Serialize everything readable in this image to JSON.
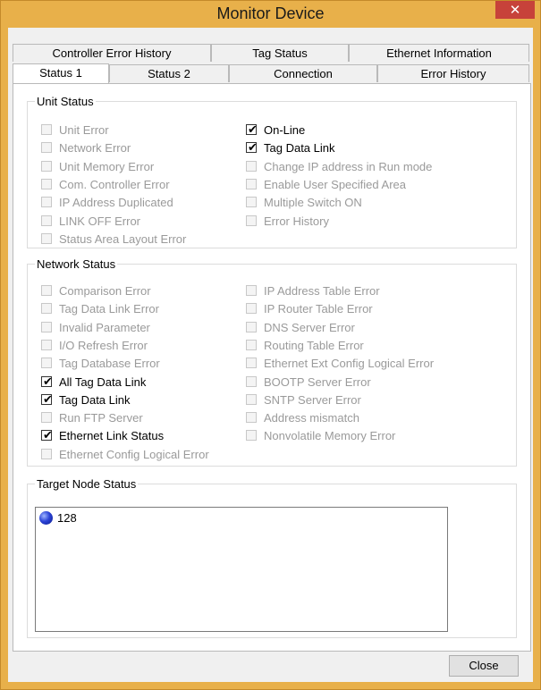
{
  "window": {
    "title": "Monitor Device",
    "close_glyph": "✕",
    "frame_color": "#e8b04a"
  },
  "tabs": {
    "row_back": [
      "Controller Error History",
      "Tag Status",
      "Ethernet Information"
    ],
    "row_front": [
      "Status 1",
      "Status 2",
      "Connection",
      "Error History"
    ],
    "active": "Status 1"
  },
  "unit_status": {
    "title": "Unit Status",
    "left": [
      {
        "label": "Unit Error",
        "checked": false
      },
      {
        "label": "Network Error",
        "checked": false
      },
      {
        "label": "Unit Memory Error",
        "checked": false
      },
      {
        "label": "Com. Controller Error",
        "checked": false
      },
      {
        "label": "IP Address Duplicated",
        "checked": false
      },
      {
        "label": "LINK OFF Error",
        "checked": false
      },
      {
        "label": "Status Area Layout Error",
        "checked": false
      }
    ],
    "right": [
      {
        "label": "On-Line",
        "checked": true
      },
      {
        "label": "Tag Data Link",
        "checked": true
      },
      {
        "label": "Change IP address in Run mode",
        "checked": false
      },
      {
        "label": "Enable User Specified Area",
        "checked": false
      },
      {
        "label": "Multiple Switch ON",
        "checked": false
      },
      {
        "label": "Error History",
        "checked": false
      }
    ]
  },
  "network_status": {
    "title": "Network Status",
    "left": [
      {
        "label": "Comparison Error",
        "checked": false
      },
      {
        "label": "Tag Data Link Error",
        "checked": false
      },
      {
        "label": "Invalid Parameter",
        "checked": false
      },
      {
        "label": "I/O Refresh Error",
        "checked": false
      },
      {
        "label": "Tag Database Error",
        "checked": false
      },
      {
        "label": "All Tag Data Link",
        "checked": true
      },
      {
        "label": "Tag Data Link",
        "checked": true
      },
      {
        "label": "Run FTP Server",
        "checked": false
      },
      {
        "label": "Ethernet Link Status",
        "checked": true
      },
      {
        "label": "Ethernet Config Logical Error",
        "checked": false
      }
    ],
    "right": [
      {
        "label": "IP Address Table Error",
        "checked": false
      },
      {
        "label": "IP Router Table Error",
        "checked": false
      },
      {
        "label": "DNS Server Error",
        "checked": false
      },
      {
        "label": "Routing Table Error",
        "checked": false
      },
      {
        "label": "Ethernet Ext Config Logical Error",
        "checked": false
      },
      {
        "label": "BOOTP Server Error",
        "checked": false
      },
      {
        "label": "SNTP Server Error",
        "checked": false
      },
      {
        "label": "Address mismatch",
        "checked": false
      },
      {
        "label": "Nonvolatile Memory Error",
        "checked": false
      }
    ]
  },
  "target_node_status": {
    "title": "Target Node Status",
    "nodes": [
      {
        "label": "128",
        "icon": "blue-node-icon"
      }
    ]
  },
  "footer": {
    "close_label": "Close"
  },
  "checkmark_glyph": "✔"
}
